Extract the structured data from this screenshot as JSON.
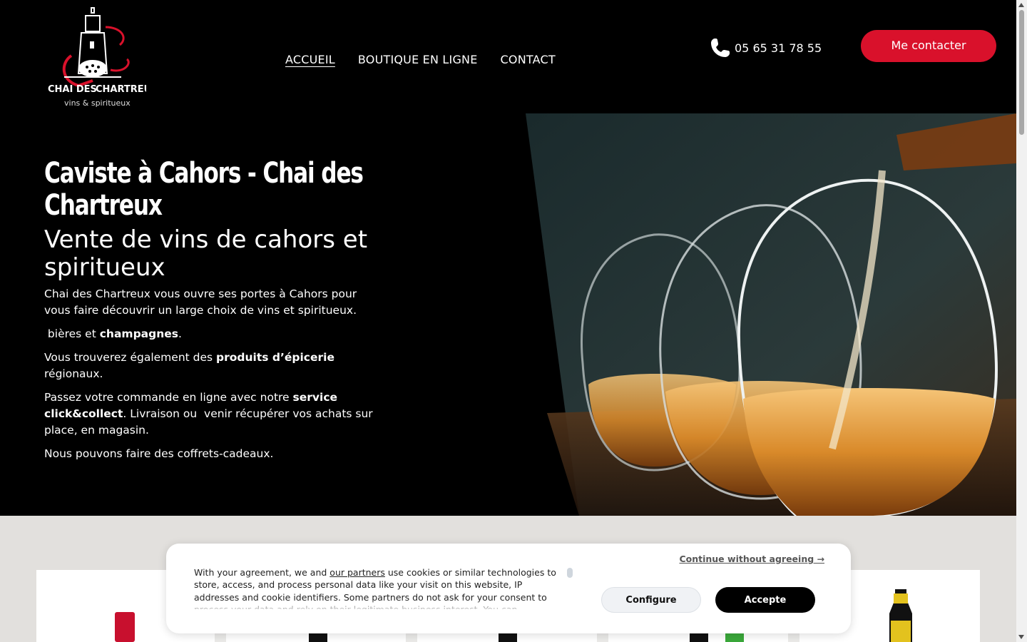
{
  "header": {
    "logo": {
      "brand_line1": "CHAI DES",
      "brand_line2": "CHARTREUX",
      "tagline": "vins & spiritueux"
    },
    "nav": [
      {
        "label": "ACCUEIL",
        "active": true
      },
      {
        "label": "BOUTIQUE EN LIGNE",
        "active": false
      },
      {
        "label": "CONTACT",
        "active": false
      }
    ],
    "phone": {
      "icon": "phone-icon",
      "number": "05 65 31 78 55"
    },
    "contact_button": "Me contacter",
    "accent_color": "#d9112b"
  },
  "hero": {
    "title": "Caviste à Cahors - Chai des Chartreux",
    "subtitle": "Vente de vins de cahors et spiritueux",
    "p1": "Chai des Chartreux vous ouvre ses portes à Cahors pour vous faire découvrir un large choix de vins et spiritueux.",
    "p2_pre": " bières et ",
    "p2_bold": "champagnes",
    "p2_post": ".",
    "p3_pre": "Vous trouverez également des ",
    "p3_bold": "produits d’épicerie",
    "p3_post": " régionaux.",
    "p4_pre": "Passez votre commande en ligne avec notre ",
    "p4_bold": "service click&collect",
    "p4_post": ". Livraison ou  venir récupérer vos achats sur place, en magasin.",
    "p5": "Nous pouvons faire des coffrets-cadeaux.",
    "image": "wine-glasses-pour-photo"
  },
  "cookie_banner": {
    "text_pre": "With your agreement, we and ",
    "partners_link": "our partners",
    "text_post": " use cookies or similar technologies to store, access, and process personal data like your visit on this website, IP addresses and cookie identifiers. Some partners do not ask for your consent to process your data and rely on their legitimate business interest. You can",
    "continue_link": "Continue without agreeing →",
    "configure_button": "Configure",
    "accept_button": "Accepte"
  }
}
